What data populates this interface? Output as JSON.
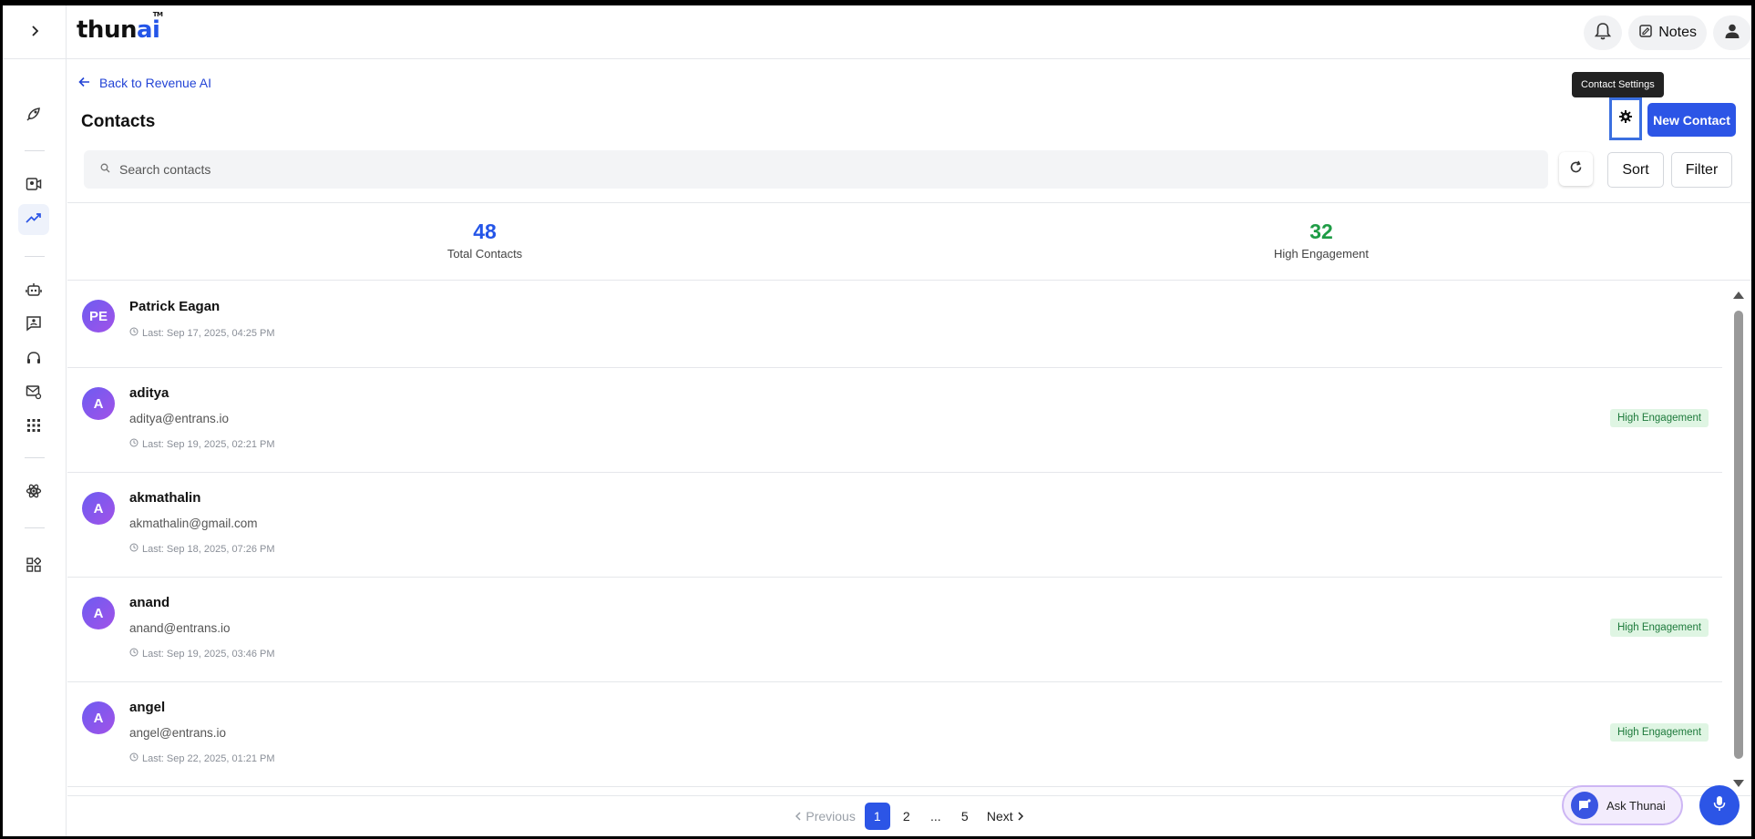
{
  "app": {
    "logo_text": "thun",
    "logo_accent": "ai",
    "logo_tm": "TM"
  },
  "header": {
    "notes_label": "Notes"
  },
  "nav": {
    "back_label": "Back to Revenue AI"
  },
  "page": {
    "title": "Contacts",
    "settings_tooltip": "Contact Settings",
    "new_contact_label": "New Contact"
  },
  "search": {
    "placeholder": "Search contacts"
  },
  "toolbar": {
    "sort_label": "Sort",
    "filter_label": "Filter"
  },
  "stats": [
    {
      "value": "48",
      "label": "Total Contacts",
      "color": "#2455e8"
    },
    {
      "value": "32",
      "label": "High Engagement",
      "color": "#1e9c45"
    }
  ],
  "contacts": [
    {
      "initials": "PE",
      "name": "Patrick Eagan",
      "email": "",
      "last": "Last: Sep 17, 2025, 04:25 PM",
      "badge": ""
    },
    {
      "initials": "A",
      "name": "aditya",
      "email": "aditya@entrans.io",
      "last": "Last: Sep 19, 2025, 02:21 PM",
      "badge": "High Engagement"
    },
    {
      "initials": "A",
      "name": "akmathalin",
      "email": "akmathalin@gmail.com",
      "last": "Last: Sep 18, 2025, 07:26 PM",
      "badge": ""
    },
    {
      "initials": "A",
      "name": "anand",
      "email": "anand@entrans.io",
      "last": "Last: Sep 19, 2025, 03:46 PM",
      "badge": "High Engagement"
    },
    {
      "initials": "A",
      "name": "angel",
      "email": "angel@entrans.io",
      "last": "Last: Sep 22, 2025, 01:21 PM",
      "badge": "High Engagement"
    }
  ],
  "pagination": {
    "previous": "Previous",
    "pages": [
      "1",
      "2",
      "...",
      "5"
    ],
    "next": "Next",
    "current": "1"
  },
  "assistant": {
    "ask_label": "Ask Thunai"
  },
  "colors": {
    "accent": "#2c55e6",
    "badge_bg": "#dff5e3",
    "badge_text": "#1e7a3c"
  }
}
